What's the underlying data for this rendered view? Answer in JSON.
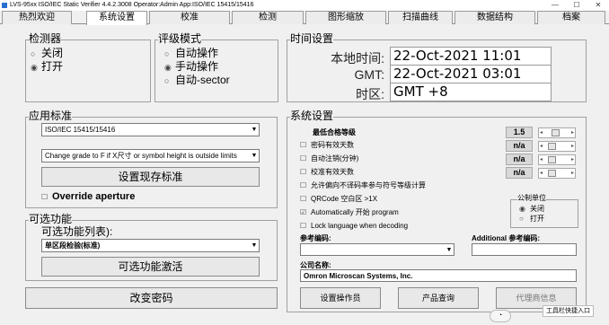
{
  "window": {
    "title": "LVS-95xx ISO/IEC Static Verifier 4.4.2.3008   Operator:Admin   App:ISO/IEC 15415/15416",
    "minimize": "—",
    "maximize": "☐",
    "close": "✕"
  },
  "tabs": [
    {
      "label": "热烈欢迎"
    },
    {
      "label": "系统设置"
    },
    {
      "label": "校准"
    },
    {
      "label": "检测"
    },
    {
      "label": "图形缩放"
    },
    {
      "label": "扫描曲线"
    },
    {
      "label": "数据结构"
    },
    {
      "label": "档案"
    }
  ],
  "detector": {
    "title": "检测器",
    "options": [
      {
        "label": "关闭",
        "selected": false
      },
      {
        "label": "打开",
        "selected": true
      }
    ]
  },
  "grading": {
    "title": "评级模式",
    "options": [
      {
        "label": "自动操作",
        "selected": false
      },
      {
        "label": "手动操作",
        "selected": true
      },
      {
        "label": "自动-sector",
        "selected": false
      }
    ]
  },
  "time": {
    "title": "时间设置",
    "local_label": "本地时间:",
    "local_value": "22-Oct-2021 11:01",
    "gmt_label": "GMT:",
    "gmt_value": "22-Oct-2021 03:01",
    "zone_label": "时区:",
    "zone_value": "GMT +8"
  },
  "standard": {
    "title": "应用标准",
    "selected": "ISO/IEC 15415/15416",
    "rule": "Change grade to F if X尺寸 or symbol height is outside limits",
    "set_button": "设置现存标准",
    "override_label": "Override aperture",
    "override_checked": false
  },
  "optional": {
    "title": "可选功能",
    "list_label": "可选功能列表):",
    "selected": "单区段检验(标准)",
    "activate_button": "可选功能激活"
  },
  "change_password_button": "改变密码",
  "system": {
    "title": "系统设置",
    "min_grade_label": "最低合格等级",
    "min_grade_value": "1.5",
    "password_days_label": "密码有效天数",
    "password_days_value": "n/a",
    "auto_logout_label": "自动注销(分钟)",
    "auto_logout_value": "n/a",
    "calibration_days_label": "校准有效天数",
    "calibration_days_value": "n/a",
    "allow_label": "允许偏向不译码率参与符号等级计算",
    "qrcode_label": "QRCode 空白区 >1X",
    "auto_program_label": "Automatically 开始 program",
    "auto_program_checked": true,
    "lock_language_label": "Lock language when decoding",
    "units_title": "公制单位",
    "units_off": "关闭",
    "units_on": "打开",
    "units_off_selected": true,
    "ref_code_label": "参考编码:",
    "additional_label": "Additional 参考编码:",
    "company_label": "公司名称:",
    "company_value": "Omron Microscan Systems, Inc.",
    "set_operator_button": "设置操作员",
    "product_query_button": "产品查询",
    "agent_info_button": "代理商信息"
  },
  "taskbar": {
    "toolbar_label": "工具栏快捷入口"
  },
  "colors": {
    "window_bg": "#f0f0f0",
    "field_bg": "#ffffff",
    "border": "#a0a0a0"
  }
}
